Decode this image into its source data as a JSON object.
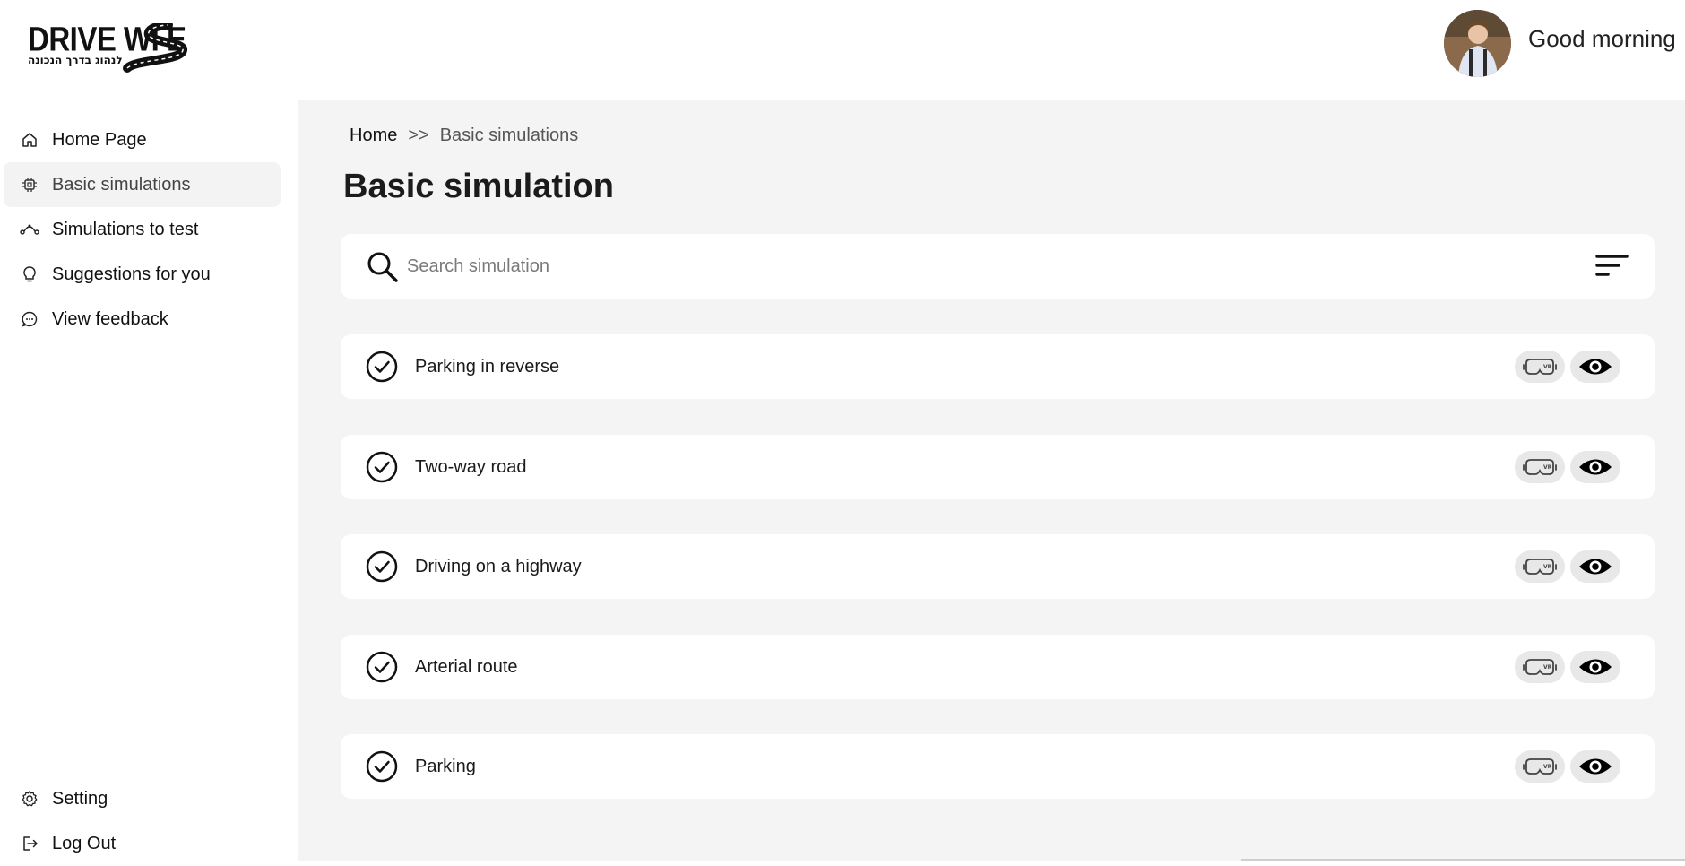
{
  "brand": {
    "logo_main": "DRIVE WI  E",
    "logo_sub": "לנהוג בדרך הנכונה"
  },
  "header": {
    "greeting": "Good morning"
  },
  "sidebar": {
    "items": [
      {
        "label": "Home Page",
        "icon": "home-icon"
      },
      {
        "label": "Basic simulations",
        "icon": "chip-icon",
        "active": true
      },
      {
        "label": "Simulations to test",
        "icon": "route-icon"
      },
      {
        "label": "Suggestions for you",
        "icon": "lightbulb-icon"
      },
      {
        "label": "View feedback",
        "icon": "chat-icon"
      }
    ],
    "bottom_items": [
      {
        "label": "Setting",
        "icon": "gear-icon"
      },
      {
        "label": "Log Out",
        "icon": "logout-icon"
      }
    ]
  },
  "breadcrumb": {
    "home": "Home",
    "separator": ">>",
    "current": "Basic simulations"
  },
  "page": {
    "title": "Basic simulation"
  },
  "search": {
    "placeholder": "Search simulation",
    "value": ""
  },
  "simulations": [
    {
      "title": "Parking in reverse"
    },
    {
      "title": "Two-way road"
    },
    {
      "title": "Driving on a highway"
    },
    {
      "title": "Arterial route"
    },
    {
      "title": "Parking"
    }
  ],
  "colors": {
    "main_bg": "#f4f4f4",
    "active_nav_bg": "#f3f3f3",
    "card_bg": "#ffffff",
    "pill_bg": "#e8e8e8"
  }
}
